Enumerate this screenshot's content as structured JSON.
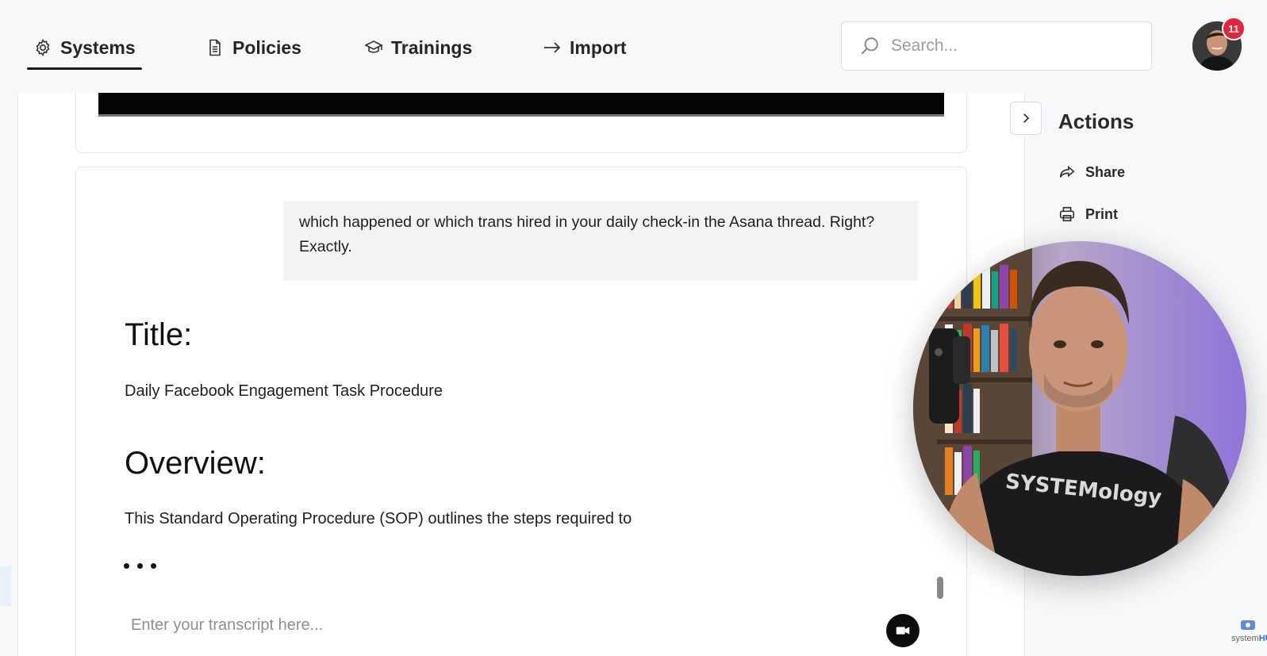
{
  "nav": {
    "tabs": [
      {
        "label": "Systems",
        "icon": "gear-icon",
        "active": true
      },
      {
        "label": "Policies",
        "icon": "document-icon",
        "active": false
      },
      {
        "label": "Trainings",
        "icon": "graduation-cap-icon",
        "active": false
      },
      {
        "label": "Import",
        "icon": "arrow-right-icon",
        "active": false
      }
    ],
    "search_placeholder": "Search...",
    "notification_count": "11"
  },
  "content": {
    "chat_bubble_text": "which happened or which trans hired in your daily check-in the Asana thread. Right? Exactly.",
    "title_heading": "Title:",
    "title_text": "Daily Facebook Engagement Task Procedure",
    "overview_heading": "Overview:",
    "overview_text": "This Standard Operating Procedure (SOP) outlines the steps required to",
    "transcript_placeholder": "Enter your transcript here..."
  },
  "actions": {
    "title": "Actions",
    "items": [
      {
        "label": "Share",
        "icon": "share-icon"
      },
      {
        "label": "Print",
        "icon": "printer-icon"
      }
    ]
  },
  "webcam": {
    "shirt_text": "SYSTEMology"
  },
  "brand": {
    "logo_text_1": "system",
    "logo_text_2": "HUB"
  },
  "colors": {
    "accent": "#1a1a1a",
    "badge": "#e1263b",
    "brand": "#3b6fb6"
  }
}
